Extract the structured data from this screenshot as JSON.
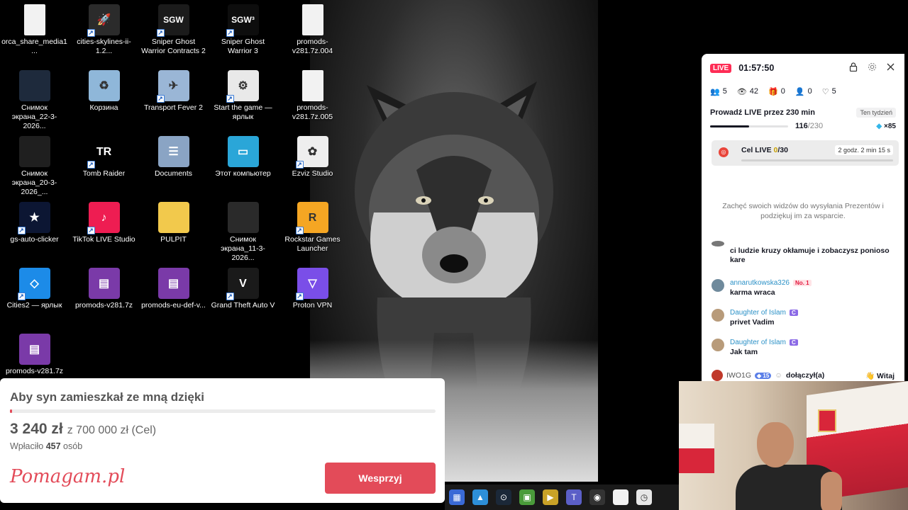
{
  "desktop": {
    "icons": [
      {
        "label": "orca_share_media1...",
        "icon": "file-icon",
        "color": "#f2f2f2",
        "glyph": ""
      },
      {
        "label": "cities-skylines-ii-1.2...",
        "icon": "rocket-icon",
        "color": "#2b2b2b",
        "glyph": "🚀"
      },
      {
        "label": "Sniper Ghost Warrior Contracts 2",
        "icon": "sgw-icon",
        "color": "#1b1b1b",
        "glyph": "SGW"
      },
      {
        "label": "Sniper Ghost Warrior 3",
        "icon": "sgw3-icon",
        "color": "#0d0d0d",
        "glyph": "SGW³"
      },
      {
        "label": "promods-v281.7z.004",
        "icon": "file-icon",
        "color": "#f2f2f2",
        "glyph": ""
      },
      {
        "label": "Снимок экрана_22-3-2026...",
        "icon": "screenshot-icon",
        "color": "#1e2a3c",
        "glyph": ""
      },
      {
        "label": "Корзина",
        "icon": "recycle-bin-icon",
        "color": "#8fb7d9",
        "glyph": "♻"
      },
      {
        "label": "Transport Fever 2",
        "icon": "transport-fever-icon",
        "color": "#9ab6d6",
        "glyph": "✈"
      },
      {
        "label": "Start the game — ярлык",
        "icon": "settings-shortcut-icon",
        "color": "#e9e9e9",
        "glyph": "⚙"
      },
      {
        "label": "promods-v281.7z.005",
        "icon": "file-icon",
        "color": "#f2f2f2",
        "glyph": ""
      },
      {
        "label": "Снимок экрана_20-3-2026_...",
        "icon": "screenshot-icon",
        "color": "#1f1f1f",
        "glyph": ""
      },
      {
        "label": "Tomb Raider",
        "icon": "tomb-raider-icon",
        "color": "#000000",
        "glyph": "TR"
      },
      {
        "label": "Documents",
        "icon": "documents-folder-icon",
        "color": "#8aa4c4",
        "glyph": "☰"
      },
      {
        "label": "Этот компьютер",
        "icon": "computer-icon",
        "color": "#2aa6d8",
        "glyph": "▭"
      },
      {
        "label": "Ezviz Studio",
        "icon": "ezviz-icon",
        "color": "#eeeeee",
        "glyph": "✿"
      },
      {
        "label": "gs-auto-clicker",
        "icon": "star-icon",
        "color": "#0c1633",
        "glyph": "★"
      },
      {
        "label": "TikTok LIVE Studio",
        "icon": "tiktok-icon",
        "color": "#ee1d52",
        "glyph": "♪"
      },
      {
        "label": "PULPIT",
        "icon": "folder-icon",
        "color": "#f2c94c",
        "glyph": ""
      },
      {
        "label": "Снимок экрана_11-3-2026...",
        "icon": "screenshot-icon",
        "color": "#2a2a2a",
        "glyph": ""
      },
      {
        "label": "Rockstar Games Launcher",
        "icon": "rockstar-icon",
        "color": "#f5a623",
        "glyph": "R"
      },
      {
        "label": "Cities2 — ярлык",
        "icon": "cities2-icon",
        "color": "#1c8be8",
        "glyph": "◇"
      },
      {
        "label": "promods-v281.7z",
        "icon": "winrar-icon",
        "color": "#7a3aa8",
        "glyph": "▤"
      },
      {
        "label": "promods-eu-def-v...",
        "icon": "winrar-icon",
        "color": "#7a3aa8",
        "glyph": "▤"
      },
      {
        "label": "Grand Theft Auto V",
        "icon": "gta-icon",
        "color": "#1a1a1a",
        "glyph": "V"
      },
      {
        "label": "Proton VPN",
        "icon": "protonvpn-icon",
        "color": "#7a4ee8",
        "glyph": "▽"
      },
      {
        "label": "promods-v281.7z",
        "icon": "winrar-icon",
        "color": "#7a3aa8",
        "glyph": "▤"
      }
    ]
  },
  "live": {
    "badge": "LIVE",
    "timer": "01:57:50",
    "stats": {
      "viewers": "5",
      "views": "42",
      "gifts": "0",
      "new_followers": "0",
      "likes": "5"
    },
    "weekly_goal": {
      "title": "Prowadź LIVE przez 230 min",
      "period": "Ten tydzień",
      "current": "116",
      "total": "/230",
      "progress": 0.504,
      "reward": "×85"
    },
    "cel": {
      "label": "Cel LIVE ",
      "current": "0",
      "total": "/30",
      "time_left": "2 godz. 2 min 15 s",
      "progress": 0.0
    },
    "encourage_text": "Zachęć swoich widzów do wysyłania Prezentów i podziękuj im za wsparcie.",
    "chat": [
      {
        "user": "",
        "badge": "",
        "badge_type": "",
        "text": "ci ludzie kruzy okłamuje i zobaczysz ponioso kare",
        "avatar_color": "#777777"
      },
      {
        "user": "annarutkowska326",
        "badge": "No. 1",
        "badge_type": "no1",
        "text": "karma wraca",
        "avatar_color": "#6f8a9c"
      },
      {
        "user": "Daughter of Islam",
        "badge": "C",
        "badge_type": "c",
        "text": "privet Vadim",
        "avatar_color": "#b89b7a"
      },
      {
        "user": "Daughter of Islam",
        "badge": "C",
        "badge_type": "c",
        "text": "Jak tam",
        "avatar_color": "#b89b7a"
      }
    ],
    "joined": {
      "user": "IWO1G",
      "level": "15",
      "text": "dołączył(a)",
      "button": "Witaj"
    }
  },
  "pomagam": {
    "title": "Aby syn zamieszkał ze mną dzięki",
    "raised": "3 240 zł",
    "goal": "z 700 000 zł (Cel)",
    "progress": 0.0046,
    "donors_prefix": "Wpłaciło ",
    "donors_count": "457",
    "donors_suffix": " osób",
    "logo": "Pomagam.pl",
    "button": "Wesprzyj"
  },
  "taskbar": [
    {
      "icon": "app-icon-1",
      "color": "#3a6ad6",
      "glyph": "▦"
    },
    {
      "icon": "photos-icon",
      "color": "#2d8fd8",
      "glyph": "▲"
    },
    {
      "icon": "steam-icon",
      "color": "#1b2838",
      "glyph": "⊙"
    },
    {
      "icon": "game-icon",
      "color": "#4a9b3a",
      "glyph": "▣"
    },
    {
      "icon": "media-player-icon",
      "color": "#c9a227",
      "glyph": "▶"
    },
    {
      "icon": "teams-icon",
      "color": "#5b5fc7",
      "glyph": "T"
    },
    {
      "icon": "obs-icon",
      "color": "#333333",
      "glyph": "◉"
    },
    {
      "icon": "file-icon",
      "color": "#f2f2f2",
      "glyph": ""
    },
    {
      "icon": "clock-icon",
      "color": "#e6e6e6",
      "glyph": "◷"
    }
  ]
}
